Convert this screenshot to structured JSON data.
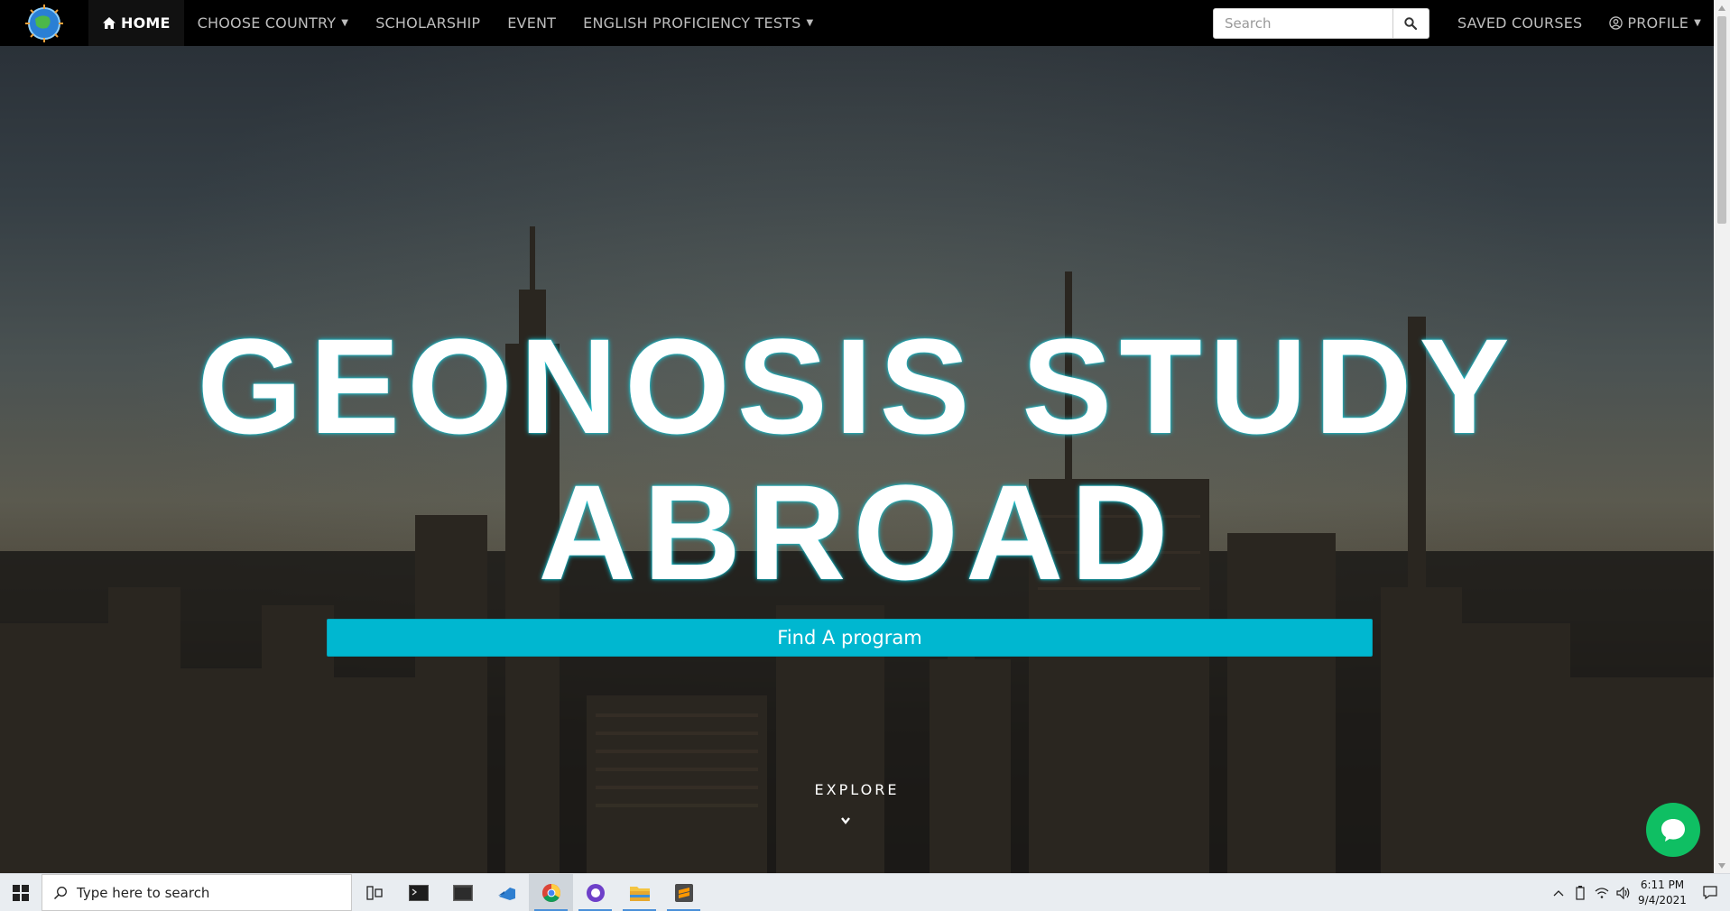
{
  "navbar": {
    "items": [
      {
        "label": "HOME",
        "icon": "home-icon"
      },
      {
        "label": "CHOOSE COUNTRY",
        "dropdown": true
      },
      {
        "label": "SCHOLARSHIP"
      },
      {
        "label": "EVENT"
      },
      {
        "label": "ENGLISH PROFICIENCY TESTS",
        "dropdown": true
      }
    ],
    "search_placeholder": "Search",
    "saved_courses": "SAVED COURSES",
    "profile": "PROFILE"
  },
  "hero": {
    "title_line1": "GEONOSIS STUDY",
    "title_line2": "ABROAD",
    "cta_label": "Find A program",
    "explore_label": "EXPLORE"
  },
  "taskbar": {
    "search_placeholder": "Type here to search",
    "time": "6:11 PM",
    "date": "9/4/2021",
    "apps": [
      "task-view-icon",
      "terminal-icon",
      "window-icon",
      "vscode-icon",
      "chrome-icon",
      "github-desktop-icon",
      "file-explorer-icon",
      "sublime-text-icon"
    ]
  },
  "colors": {
    "accent": "#00b7d0",
    "chat": "#0fbf63",
    "navbar": "#000000"
  }
}
